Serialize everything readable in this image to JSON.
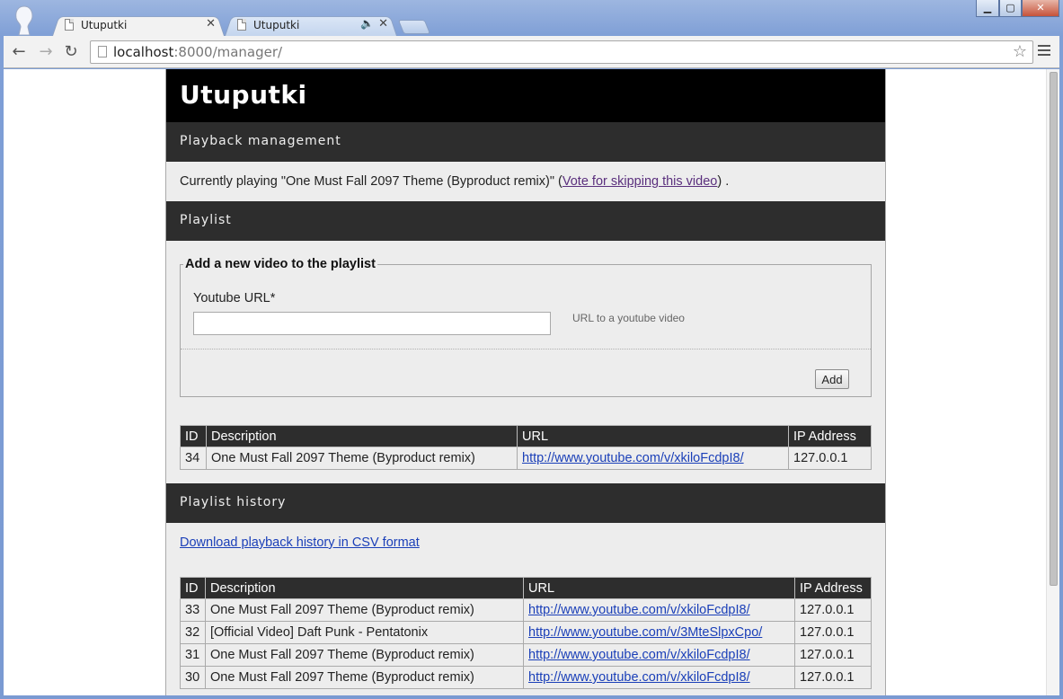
{
  "browser": {
    "tabs": [
      {
        "title": "Utuputki",
        "active": true
      },
      {
        "title": "Utuputki",
        "active": false,
        "audio": true
      }
    ],
    "address": {
      "host": "localhost",
      "rest": ":8000/manager/"
    },
    "window_controls": {
      "minimize": "▁",
      "maximize": "▢",
      "close": "✕"
    }
  },
  "site": {
    "title": "Utuputki"
  },
  "playback": {
    "heading": "Playback management",
    "text_before": "Currently playing \"One Must Fall 2097 Theme (Byproduct remix)\" (",
    "vote_link": "Vote for skipping this video",
    "text_after": ") ."
  },
  "playlist": {
    "heading": "Playlist",
    "form": {
      "legend": "Add a new video to the playlist",
      "field_label": "Youtube URL*",
      "field_value": "",
      "help": "URL to a youtube video",
      "submit": "Add"
    },
    "columns": [
      "ID",
      "Description",
      "URL",
      "IP Address"
    ],
    "rows": [
      {
        "id": "34",
        "description": "One Must Fall 2097 Theme (Byproduct remix)",
        "url": "http://www.youtube.com/v/xkiloFcdpI8/",
        "ip": "127.0.0.1"
      }
    ]
  },
  "history": {
    "heading": "Playlist history",
    "csv_link": "Download playback history in CSV format",
    "columns": [
      "ID",
      "Description",
      "URL",
      "IP Address"
    ],
    "rows": [
      {
        "id": "33",
        "description": "One Must Fall 2097 Theme (Byproduct remix)",
        "url": "http://www.youtube.com/v/xkiloFcdpI8/",
        "ip": "127.0.0.1"
      },
      {
        "id": "32",
        "description": "[Official Video] Daft Punk - Pentatonix",
        "url": "http://www.youtube.com/v/3MteSlpxCpo/",
        "ip": "127.0.0.1"
      },
      {
        "id": "31",
        "description": "One Must Fall 2097 Theme (Byproduct remix)",
        "url": "http://www.youtube.com/v/xkiloFcdpI8/",
        "ip": "127.0.0.1"
      },
      {
        "id": "30",
        "description": "One Must Fall 2097 Theme (Byproduct remix)",
        "url": "http://www.youtube.com/v/xkiloFcdpI8/",
        "ip": "127.0.0.1"
      }
    ]
  },
  "colors": {
    "header_bg": "#000000",
    "section_bg": "#2d2d2d",
    "content_bg": "#ededed",
    "link": "#1a3fb8",
    "visited_link": "#5a2f7d"
  }
}
